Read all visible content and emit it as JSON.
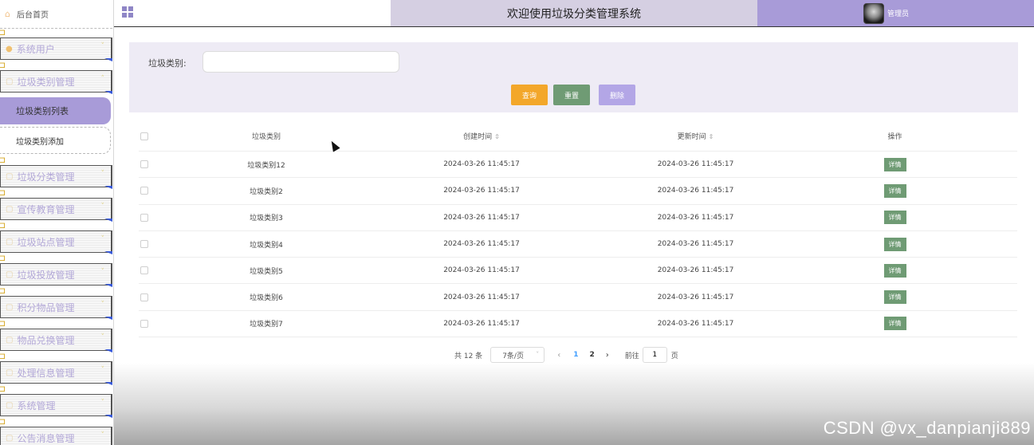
{
  "sidebar": {
    "home_label": "后台首页",
    "menu": [
      {
        "label": "系统用户",
        "icon": "user-icon"
      },
      {
        "label": "垃圾类别管理",
        "icon": "folder-icon"
      },
      {
        "label": "垃圾分类管理",
        "icon": "folder-icon"
      },
      {
        "label": "宣传教育管理",
        "icon": "folder-icon"
      },
      {
        "label": "垃圾站点管理",
        "icon": "folder-icon"
      },
      {
        "label": "垃圾投放管理",
        "icon": "folder-icon"
      },
      {
        "label": "积分物品管理",
        "icon": "folder-icon"
      },
      {
        "label": "物品兑换管理",
        "icon": "folder-icon"
      },
      {
        "label": "处理信息管理",
        "icon": "folder-icon"
      },
      {
        "label": "系统管理",
        "icon": "folder-icon"
      },
      {
        "label": "公告消息管理",
        "icon": "folder-icon"
      }
    ],
    "submenu": [
      {
        "label": "垃圾类别列表",
        "active": true
      },
      {
        "label": "垃圾类别添加",
        "active": false
      }
    ]
  },
  "header": {
    "title": "欢迎使用垃圾分类管理系统",
    "user": "管理员"
  },
  "search": {
    "label": "垃圾类别:",
    "value": "",
    "query_label": "查询",
    "reset_label": "重置",
    "delete_label": "删除"
  },
  "table": {
    "headers": {
      "type": "垃圾类别",
      "created": "创建时间",
      "updated": "更新时间",
      "op": "操作",
      "sort_glyph": "⇕"
    },
    "detail_label": "详情",
    "rows": [
      {
        "type": "垃圾类别12",
        "created": "2024-03-26 11:45:17",
        "updated": "2024-03-26 11:45:17"
      },
      {
        "type": "垃圾类别2",
        "created": "2024-03-26 11:45:17",
        "updated": "2024-03-26 11:45:17"
      },
      {
        "type": "垃圾类别3",
        "created": "2024-03-26 11:45:17",
        "updated": "2024-03-26 11:45:17"
      },
      {
        "type": "垃圾类别4",
        "created": "2024-03-26 11:45:17",
        "updated": "2024-03-26 11:45:17"
      },
      {
        "type": "垃圾类别5",
        "created": "2024-03-26 11:45:17",
        "updated": "2024-03-26 11:45:17"
      },
      {
        "type": "垃圾类别6",
        "created": "2024-03-26 11:45:17",
        "updated": "2024-03-26 11:45:17"
      },
      {
        "type": "垃圾类别7",
        "created": "2024-03-26 11:45:17",
        "updated": "2024-03-26 11:45:17"
      }
    ]
  },
  "pagination": {
    "total": "共 12 条",
    "page_size": "7条/页",
    "pages": [
      "1",
      "2"
    ],
    "current_page": "1",
    "goto_label": "前往",
    "goto_value": "1",
    "goto_suffix": "页"
  },
  "watermark": "CSDN @vx_danpianji889",
  "colors": {
    "accent_purple": "#a89bd8",
    "header_title_bg": "#d5cfe2",
    "query_button": "#f3a72a",
    "reset_button": "#6f9b74",
    "delete_button": "#b3a6e6",
    "detail_button": "#6f9b74",
    "current_page": "#409eff"
  }
}
